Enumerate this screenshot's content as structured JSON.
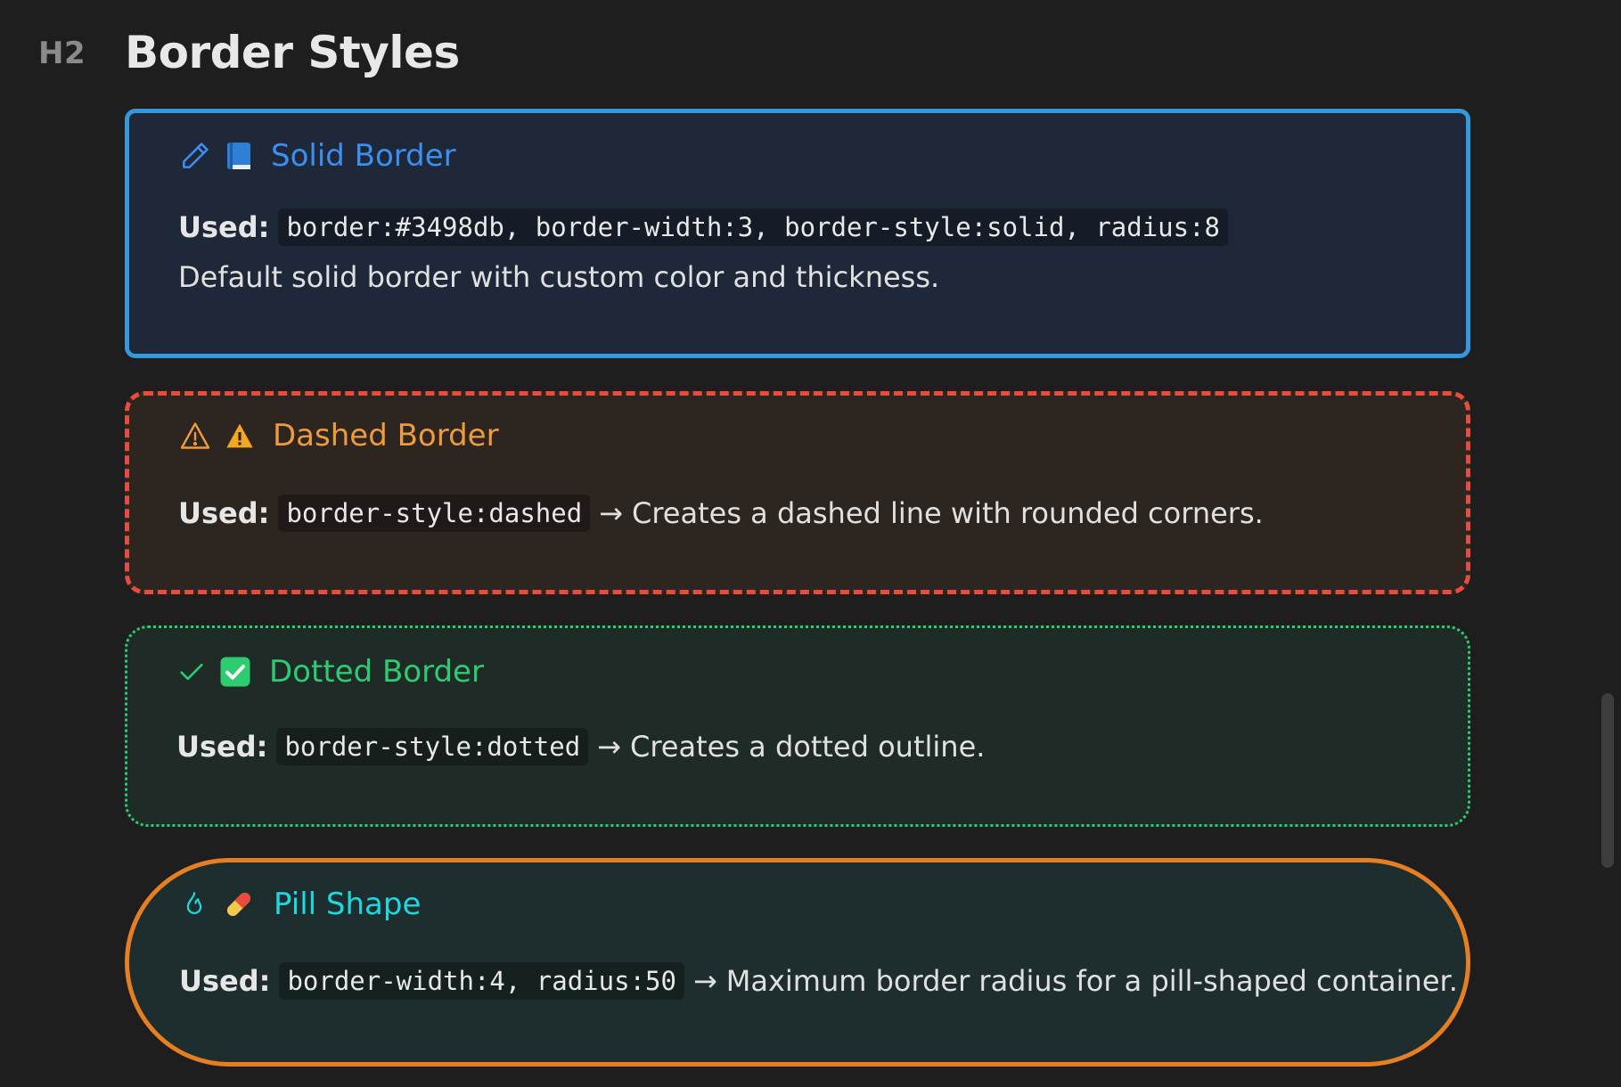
{
  "heading": {
    "marker": "H2",
    "title": "Border Styles"
  },
  "colors": {
    "solid": "#3498db",
    "dashed": "#e74c3c",
    "dotted": "#2ecc71",
    "pill": "#e67e22",
    "background": "#1e1e1e"
  },
  "callouts": {
    "solid": {
      "icons": [
        "pencil-icon",
        "blue-book-icon"
      ],
      "title": "Solid Border",
      "used_label": "Used:",
      "code": "border:#3498db, border-width:3, border-style:solid, radius:8",
      "description": "Default solid border with custom color and thickness."
    },
    "dashed": {
      "icons": [
        "warning-outline-icon",
        "warning-filled-icon"
      ],
      "title": "Dashed Border",
      "used_label": "Used:",
      "code": "border-style:dashed",
      "arrow": "→",
      "description": "Creates a dashed line with rounded corners."
    },
    "dotted": {
      "icons": [
        "check-icon",
        "check-box-icon"
      ],
      "title": "Dotted Border",
      "used_label": "Used:",
      "code": "border-style:dotted",
      "arrow": "→",
      "description": "Creates a dotted outline."
    },
    "pill": {
      "icons": [
        "flame-icon",
        "pill-icon"
      ],
      "title": "Pill Shape",
      "used_label": "Used:",
      "code": "border-width:4, radius:50",
      "arrow": "→",
      "description": "Maximum border radius for a pill-shaped container."
    }
  }
}
